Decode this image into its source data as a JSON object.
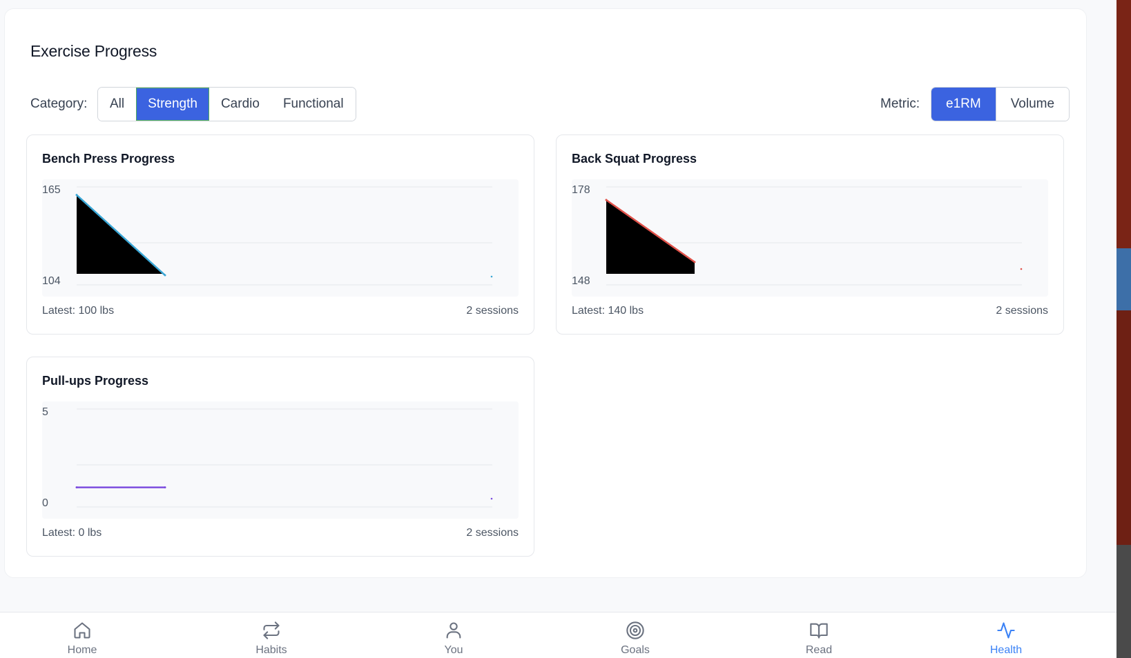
{
  "section_title": "Exercise Progress",
  "category": {
    "label": "Category:",
    "options": [
      "All",
      "Strength",
      "Cardio",
      "Functional"
    ],
    "selected": "Strength"
  },
  "metric": {
    "label": "Metric:",
    "options": [
      "e1RM",
      "Volume"
    ],
    "selected": "e1RM"
  },
  "colors": {
    "accent": "#3b63e0",
    "nav_active": "#3b82f6",
    "bench_line": "#3aa7d6",
    "squat_line": "#e0524a",
    "pullups_line": "#7c4dde"
  },
  "charts": [
    {
      "title": "Bench Press Progress",
      "y_max_label": "165",
      "y_min_label": "104",
      "latest": "Latest: 100 lbs",
      "sessions": "2 sessions"
    },
    {
      "title": "Back Squat Progress",
      "y_max_label": "178",
      "y_min_label": "148",
      "latest": "Latest: 140 lbs",
      "sessions": "2 sessions"
    },
    {
      "title": "Pull-ups Progress",
      "y_max_label": "5",
      "y_min_label": "0",
      "latest": "Latest: 0 lbs",
      "sessions": "2 sessions"
    }
  ],
  "chart_data": [
    {
      "type": "line",
      "title": "Bench Press Progress",
      "ylim": [
        104,
        165
      ],
      "series": [
        {
          "values": [
            160,
            110
          ]
        }
      ]
    },
    {
      "type": "line",
      "title": "Back Squat Progress",
      "ylim": [
        148,
        178
      ],
      "series": [
        {
          "values": [
            174,
            155
          ]
        }
      ]
    },
    {
      "type": "line",
      "title": "Pull-ups Progress",
      "ylim": [
        0,
        5
      ],
      "series": [
        {
          "values": [
            1,
            1
          ]
        }
      ]
    }
  ],
  "nav": {
    "items": [
      {
        "label": "Home",
        "icon": "home-icon"
      },
      {
        "label": "Habits",
        "icon": "repeat-icon"
      },
      {
        "label": "You",
        "icon": "user-icon"
      },
      {
        "label": "Goals",
        "icon": "target-icon"
      },
      {
        "label": "Read",
        "icon": "book-icon"
      },
      {
        "label": "Health",
        "icon": "activity-icon"
      }
    ],
    "active": "Health"
  }
}
